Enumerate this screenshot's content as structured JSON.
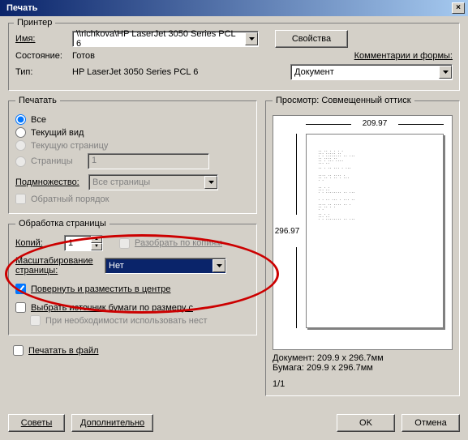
{
  "window": {
    "title": "Печать",
    "close": "×"
  },
  "printer": {
    "section_label": "Принтер",
    "name_label": "Имя:",
    "name_value": "\\\\richkova\\HP LaserJet 3050 Series PCL 6",
    "properties_btn": "Свойства",
    "status_label": "Состояние:",
    "status_value": "Готов",
    "type_label": "Тип:",
    "type_value": "HP LaserJet 3050 Series PCL 6",
    "comments_label": "Комментарии и формы:",
    "comments_value": "Документ"
  },
  "range": {
    "legend": "Печатать",
    "all": "Все",
    "current_view": "Текущий вид",
    "current_page": "Текущую страницу",
    "pages": "Страницы",
    "pages_value": "1",
    "subset_label": "Подмножество:",
    "subset_value": "Все страницы",
    "reverse": "Обратный порядок"
  },
  "handling": {
    "legend": "Обработка страницы",
    "copies_label": "Копий:",
    "copies_value": "1",
    "collate": "Разобрать по копиям",
    "scaling_label": "Масштабирование страницы:",
    "scaling_value": "Нет",
    "rotate": "Повернуть и разместить в центре",
    "source": "Выбрать источник бумаги по размеру с",
    "necessity": "При необходимости использовать нест"
  },
  "print_to_file": "Печатать в файл",
  "preview": {
    "legend": "Просмотр: Совмещенный оттиск",
    "width": "209.97",
    "height": "296.97",
    "doc_label": "Документ: 209.9 x 296.7мм",
    "paper_label": "Бумага: 209.9 x 296.7мм",
    "page_indicator": "1/1"
  },
  "buttons": {
    "tips": "Советы",
    "advanced": "Дополнительно",
    "ok": "OK",
    "cancel": "Отмена"
  }
}
